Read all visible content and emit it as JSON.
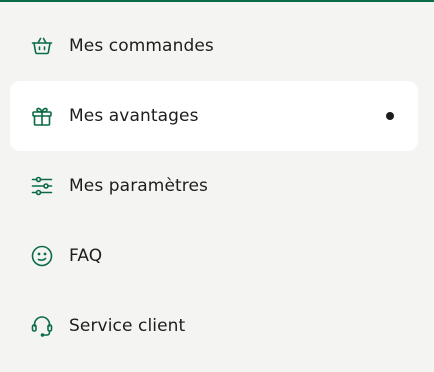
{
  "colors": {
    "accent": "#0b6b47",
    "background": "#f4f4f2",
    "active_background": "#ffffff",
    "text": "#1d1d1d",
    "indicator": "#1d1d1d"
  },
  "menu": {
    "items": [
      {
        "label": "Mes commandes",
        "icon": "shopping-basket-icon",
        "active": false
      },
      {
        "label": "Mes avantages",
        "icon": "gift-icon",
        "active": true
      },
      {
        "label": "Mes paramètres",
        "icon": "sliders-icon",
        "active": false
      },
      {
        "label": "FAQ",
        "icon": "face-icon",
        "active": false
      },
      {
        "label": "Service client",
        "icon": "headset-icon",
        "active": false
      }
    ]
  }
}
